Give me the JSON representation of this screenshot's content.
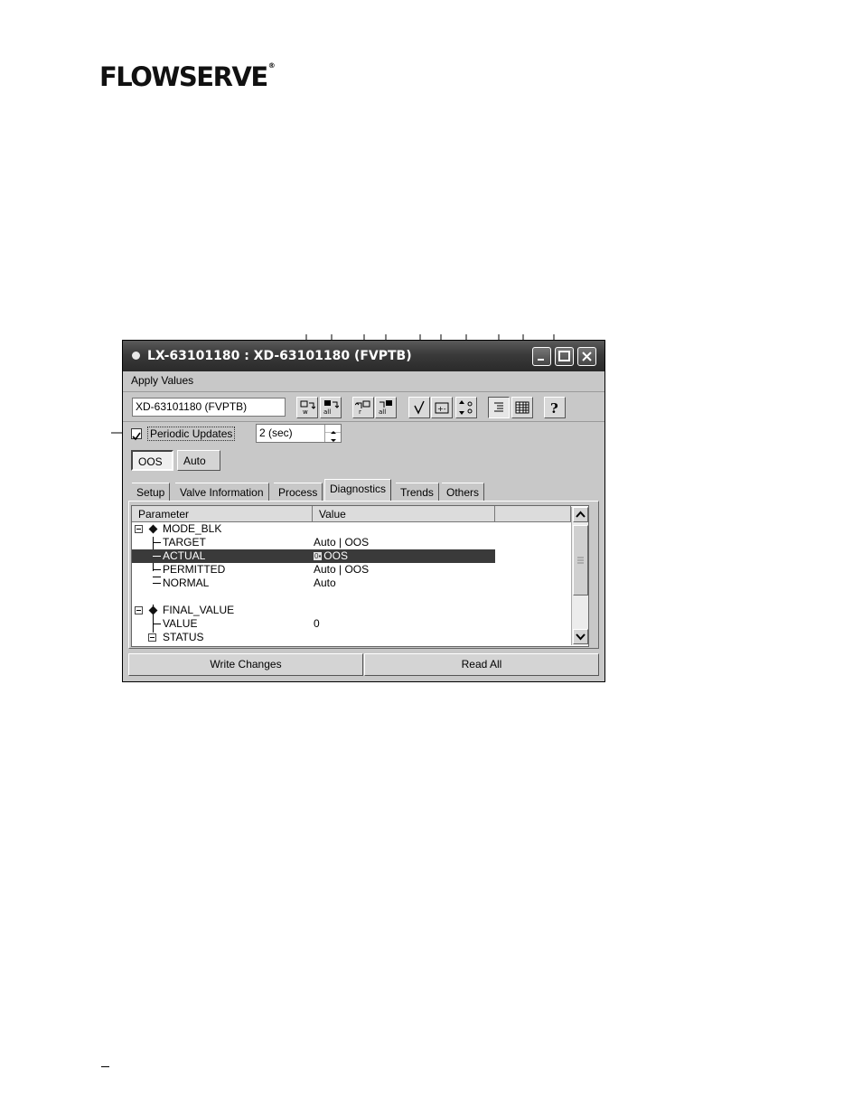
{
  "logo": {
    "text": "FLOWSERVE",
    "reg": "®"
  },
  "window": {
    "title": "LX-63101180 : XD-63101180 (FVPTB)",
    "menu": {
      "apply_values": "Apply Values"
    },
    "block_select_value": "XD-63101180 (FVPTB)",
    "periodic_updates_label": "Periodic Updates",
    "periodic_updates_checked": true,
    "update_interval": "2 (sec)",
    "modes": [
      {
        "label": "OOS",
        "active": true
      },
      {
        "label": "Auto",
        "active": false
      }
    ],
    "tabs": [
      {
        "label": "Setup",
        "active": false
      },
      {
        "label": "Valve Information",
        "active": false
      },
      {
        "label": "Process",
        "active": false
      },
      {
        "label": "Diagnostics",
        "active": true
      },
      {
        "label": "Trends",
        "active": false
      },
      {
        "label": "Others",
        "active": false
      }
    ],
    "grid": {
      "columns": {
        "parameter": "Parameter",
        "value": "Value"
      },
      "rows": [
        {
          "param": "MODE_BLK",
          "value": ""
        },
        {
          "param": "TARGET",
          "value": "Auto | OOS"
        },
        {
          "param": "ACTUAL",
          "value": "OOS",
          "selected": true,
          "lock_glyph": "0▪"
        },
        {
          "param": "PERMITTED",
          "value": "Auto | OOS"
        },
        {
          "param": "NORMAL",
          "value": "Auto"
        },
        {
          "param": "FINAL_VALUE",
          "value": ""
        },
        {
          "param": "VALUE",
          "value": "0"
        },
        {
          "param": "STATUS",
          "value": ""
        }
      ]
    },
    "buttons": {
      "write_changes": "Write Changes",
      "read_all": "Read All"
    },
    "toolbar_icons": [
      "write-icon",
      "write-all-icon",
      "read-icon",
      "read-all-icon",
      "validate-icon",
      "compare-icon",
      "sort-icon",
      "list-view-icon",
      "grid-view-icon",
      "help-icon"
    ]
  }
}
